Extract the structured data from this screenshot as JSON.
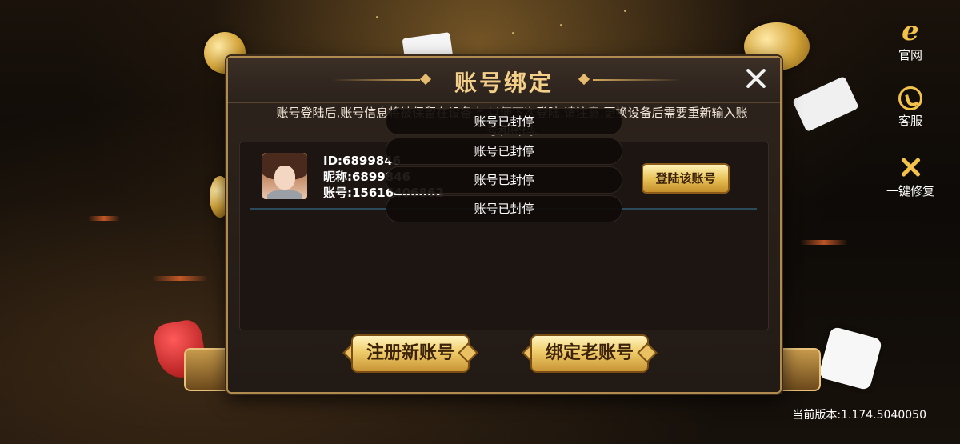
{
  "side_buttons": [
    {
      "label": "官网",
      "icon": "globe-icon"
    },
    {
      "label": "客服",
      "icon": "customer-service-icon"
    },
    {
      "label": "一键修复",
      "icon": "repair-tools-icon"
    }
  ],
  "version_text": "当前版本:1.174.5040050",
  "dialog": {
    "title": "账号绑定",
    "notice": "账号登陆后,账号信息将被保留在设备上,以便下次登陆,请注意,更换设备后需要重新输入账号和密码.",
    "account": {
      "id_line": "ID:6899846",
      "nickname_line": "昵称:6899846",
      "account_line": "账号:15616406862",
      "login_button": "登陆该账号"
    },
    "toasts": [
      "账号已封停",
      "账号已封停",
      "账号已封停",
      "账号已封停"
    ],
    "register_button": "注册新账号",
    "bind_button": "绑定老账号"
  },
  "colors": {
    "accent_gold": "#f4cf8a",
    "dialog_bg": "#2e241d",
    "border": "#b18a50"
  }
}
